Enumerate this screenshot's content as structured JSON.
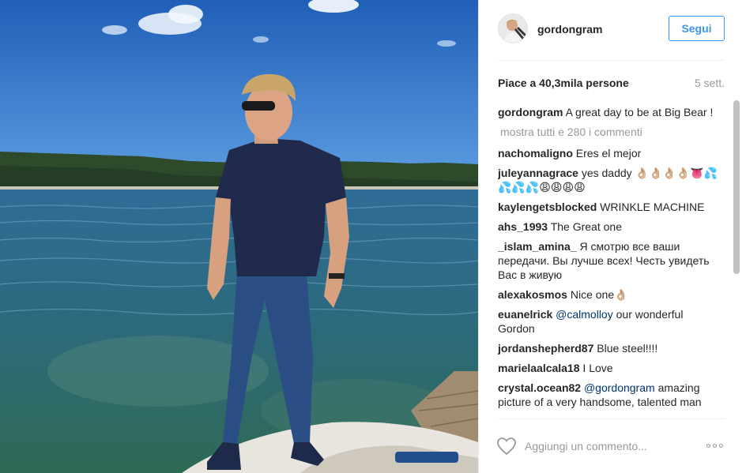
{
  "post": {
    "author": "gordongram",
    "follow_label": "Segui",
    "likes_text": "Piace a 40,3mila persone",
    "time_text": "5 sett.",
    "caption": {
      "user": "gordongram",
      "text": "A great day to be at Big Bear !"
    },
    "load_more_label": "mostra tutti e 280 i commenti",
    "comments": [
      {
        "user": "nachomaligno",
        "text": "Eres el mejor"
      },
      {
        "user": "juleyannagrace",
        "text": "yes daddy 👌🏼👌🏼👌🏼👌🏼👅💦💦💦💦😩😩😩😩"
      },
      {
        "user": "kaylengetsblocked",
        "text": "WRINKLE MACHINE"
      },
      {
        "user": "ahs_1993",
        "text": "The Great one"
      },
      {
        "user": "_islam_amina_",
        "text": "Я смотрю все ваши передачи. Вы лучше всех! Честь увидеть Вас в живую"
      },
      {
        "user": "alexakosmos",
        "text": "Nice one👌🏼"
      },
      {
        "user": "euanelrick",
        "mention": "@calmolloy",
        "text": "our wonderful Gordon"
      },
      {
        "user": "jordanshepherd87",
        "text": "Blue steel!!!!"
      },
      {
        "user": "marielaalcala18",
        "text": "I Love"
      },
      {
        "user": "crystal.ocean82",
        "mention": "@gordongram",
        "text": "amazing picture of a very handsome, talented man"
      }
    ],
    "comment_placeholder": "Aggiungi un commento...",
    "icons": {
      "like": "heart-icon",
      "more": "more-options-icon"
    },
    "colors": {
      "accent": "#3897f0",
      "muted": "#999999",
      "text": "#262626"
    }
  }
}
